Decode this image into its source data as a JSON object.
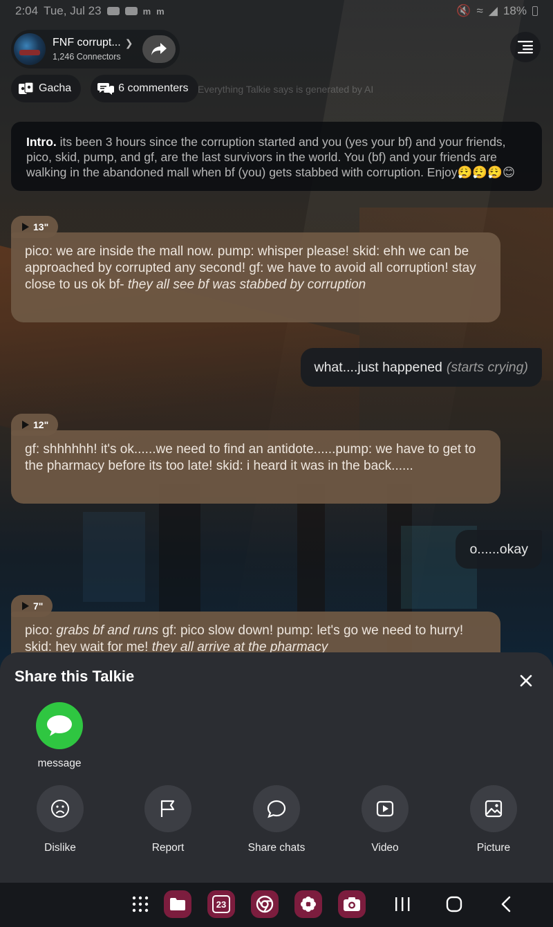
{
  "status_bar": {
    "time": "2:04",
    "date": "Tue, Jul 23",
    "battery": "18%"
  },
  "header": {
    "talkie_name": "FNF corrupt...",
    "connectors": "1,246 Connectors"
  },
  "chips": {
    "gacha": "Gacha",
    "commenters": "6 commenters",
    "disclaimer": "Everything Talkie says is generated by AI"
  },
  "chat": {
    "intro_label": "Intro.",
    "intro_text": " its been 3 hours since the corruption started and you (yes your bf) and your friends, pico, skid, pump, and gf, are the last survivors in the world. You (bf) and your friends are walking in the abandoned mall when bf (you) gets stabbed with corruption. Enjoy😮‍💨😮‍💨😮‍💨😊",
    "messages": [
      {
        "duration": "13\"",
        "plain": "pico: we are inside the mall now. pump: whisper please! skid: ehh we can be approached by corrupted any second! gf: we have to avoid all corruption! stay close to us ok bf- ",
        "italic": "they all see bf was stabbed by corruption",
        "tail": ""
      },
      {
        "user_text": "what....just happened",
        "user_italic": "(starts crying)"
      },
      {
        "duration": "12\"",
        "plain": "gf: shhhhhh! it's ok......we need to find an antidote......pump: we have to get to the pharmacy before its too late! skid: i heard it was in the back......",
        "italic": "",
        "tail": ""
      },
      {
        "user_text": "o......okay",
        "user_italic": ""
      },
      {
        "duration": "7\"",
        "plain": "pico: ",
        "italic": "grabs bf and runs",
        "tail": " gf: pico slow down! pump: let's go we need to hurry! skid: hey wait for me! ",
        "italic2": "they all arrive at the pharmacy"
      }
    ]
  },
  "share_sheet": {
    "title": "Share this Talkie",
    "message_label": "message",
    "actions": {
      "dislike": "Dislike",
      "report": "Report",
      "share_chats": "Share chats",
      "video": "Video",
      "picture": "Picture"
    }
  },
  "navbar": {
    "calendar_day": "23"
  },
  "colors": {
    "bot_bubble": "#6e5844",
    "user_bubble": "#181c22",
    "message_green": "#2fc641",
    "sheet_bg": "#2b2d32",
    "app_tile": "#7c1d3e"
  }
}
